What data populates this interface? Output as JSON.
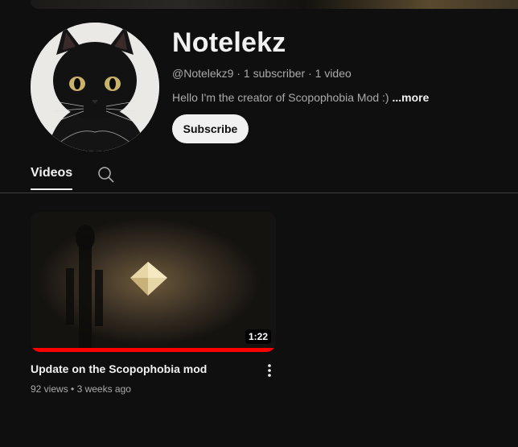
{
  "channel": {
    "name": "Notelekz",
    "handle": "@Notelekz9",
    "subscribers": "1 subscriber",
    "video_count": "1 video",
    "description": "Hello I'm the creator of Scopophobia Mod :)",
    "more_label": "...more",
    "subscribe_label": "Subscribe"
  },
  "tabs": {
    "videos_label": "Videos",
    "search_icon": "search-icon"
  },
  "videos": [
    {
      "title": "Update on the Scopophobia mod",
      "views": "92 views",
      "age": "3 weeks ago",
      "duration": "1:22",
      "watched_fraction": 1.0,
      "menu_icon": "more-vert-icon"
    }
  ],
  "colors": {
    "background": "#0f0f0f",
    "text": "#f1f1f1",
    "muted": "#aaaaaa",
    "progress": "#ff0000"
  }
}
